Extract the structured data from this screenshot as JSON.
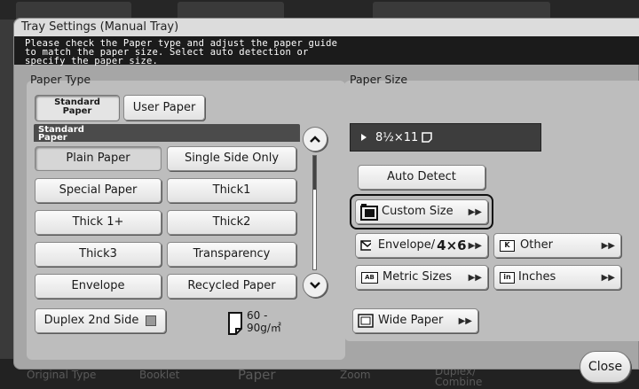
{
  "background": {
    "bottom_tabs": [
      "Original Type",
      "Booklet",
      "Paper",
      "Zoom",
      "Duplex/\nCombine"
    ]
  },
  "dialog": {
    "title": "Tray Settings (Manual Tray)",
    "message_lines": [
      "Please check the Paper type and adjust the paper guide",
      "to match the paper size. Select auto detection or",
      "specify the paper size."
    ]
  },
  "paper_type": {
    "label": "Paper Type",
    "tabs": [
      {
        "label": "Standard\nPaper",
        "selected": true
      },
      {
        "label": "User Paper",
        "selected": false
      }
    ],
    "list_header": "Standard\nPaper",
    "options": [
      [
        "Plain Paper",
        "Single Side Only"
      ],
      [
        "Special Paper",
        "Thick1"
      ],
      [
        "Thick 1+",
        "Thick2"
      ],
      [
        "Thick3",
        "Transparency"
      ],
      [
        "Envelope",
        "Recycled Paper"
      ]
    ],
    "selected_option": "Plain Paper",
    "duplex_label": "Duplex 2nd Side",
    "weight_line1": "60 -",
    "weight_line2": "90g/㎡"
  },
  "paper_size": {
    "label": "Paper Size",
    "current": "8½×11",
    "auto_detect": "Auto Detect",
    "custom_size": "Custom Size",
    "envelope_label": "Envelope/",
    "envelope_size": "4×6",
    "other": "Other",
    "metric_sizes": "Metric Sizes",
    "inches": "Inches",
    "wide_paper": "Wide Paper",
    "icon_badges": {
      "other": "K",
      "metric": "AB",
      "inches": "in"
    }
  },
  "close_label": "Close"
}
